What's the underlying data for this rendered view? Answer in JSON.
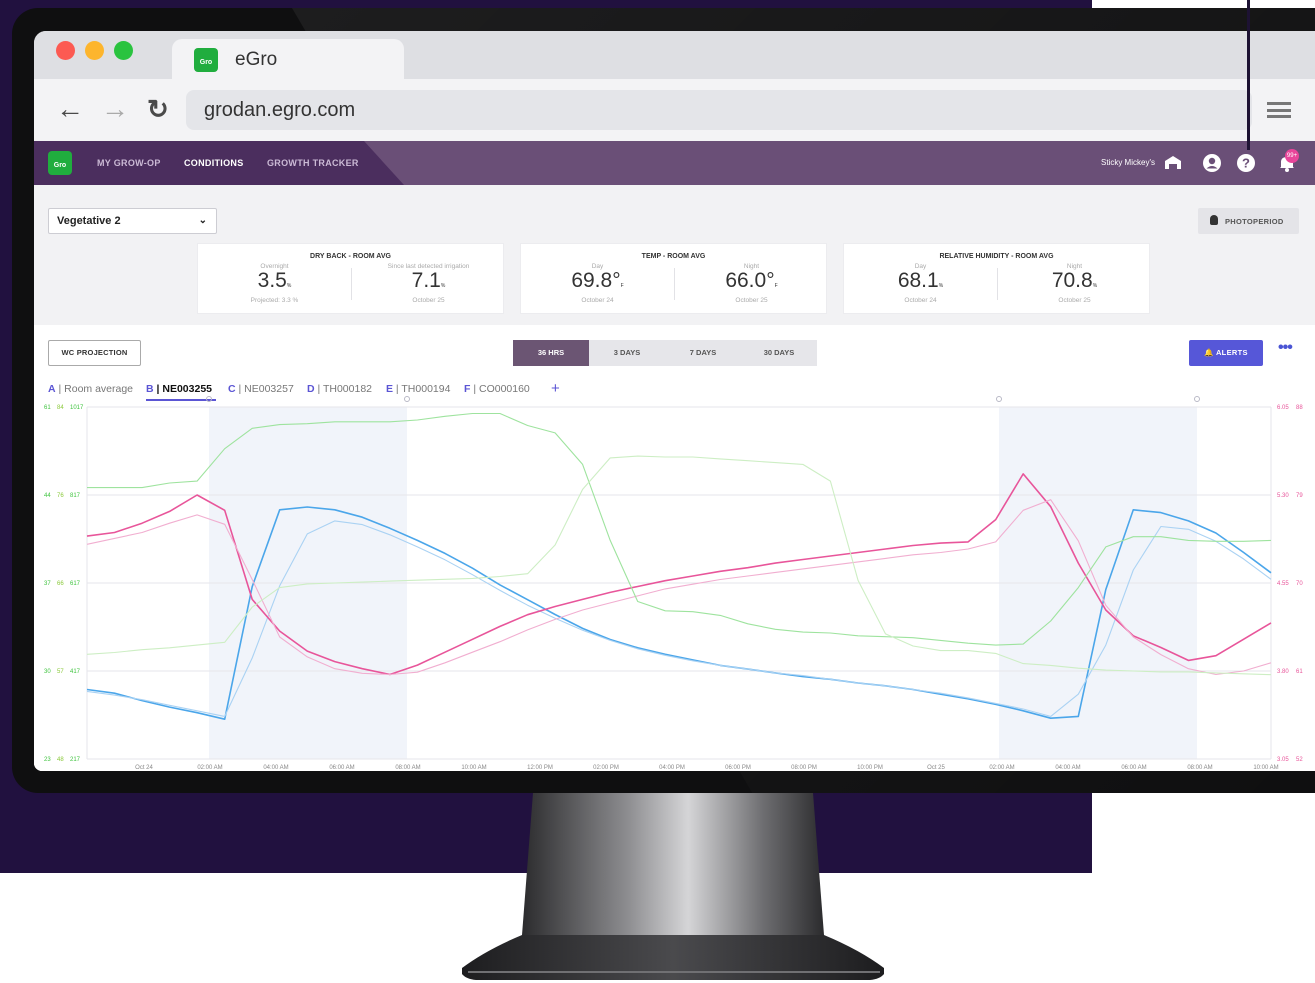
{
  "browser": {
    "tab_title": "eGro",
    "url": "grodan.egro.com",
    "back_icon": "arrow-left-icon",
    "forward_icon": "arrow-right-icon",
    "reload_icon": "reload-icon",
    "menu_icon": "hamburger-menu-icon"
  },
  "app": {
    "logo_text": "Gro",
    "nav": [
      "MY GROW-OP",
      "CONDITIONS",
      "GROWTH TRACKER"
    ],
    "active_nav": "CONDITIONS",
    "user_name": "Sticky Mickey's",
    "notification_badge": "99+",
    "brand_green": "#20ad3e",
    "nav_color": "#6a4f77"
  },
  "controls": {
    "room_select": "Vegetative 2",
    "photoperiod_label": "PHOTOPERIOD",
    "wc_projection_label": "WC PROJECTION",
    "ranges": [
      "36 HRS",
      "3 DAYS",
      "7 DAYS",
      "30 DAYS"
    ],
    "active_range": "36 HRS",
    "alerts_label": "ALERTS",
    "more_label": "•••"
  },
  "cards": [
    {
      "title": "DRY BACK - ROOM AVG",
      "left": {
        "sub": "Overnight",
        "value": "3.5",
        "unit": "%",
        "foot": "Projected: 3.3 %"
      },
      "right": {
        "sub": "Since last detected irrigation",
        "value": "7.1",
        "unit": "%",
        "foot": "October 25"
      }
    },
    {
      "title": "TEMP - ROOM AVG",
      "left": {
        "sub": "Day",
        "value": "69.8°",
        "unit": "F",
        "foot": "October 24"
      },
      "right": {
        "sub": "Night",
        "value": "66.0°",
        "unit": "F",
        "foot": "October 25"
      }
    },
    {
      "title": "RELATIVE HUMIDITY - ROOM AVG",
      "left": {
        "sub": "Day",
        "value": "68.1",
        "unit": "%",
        "foot": "October 24"
      },
      "right": {
        "sub": "Night",
        "value": "70.8",
        "unit": "%",
        "foot": "October 25"
      }
    }
  ],
  "sensor_tabs": [
    {
      "letter": "A",
      "name": "Room average"
    },
    {
      "letter": "B",
      "name": "NE003255"
    },
    {
      "letter": "C",
      "name": "NE003257"
    },
    {
      "letter": "D",
      "name": "TH000182"
    },
    {
      "letter": "E",
      "name": "TH000194"
    },
    {
      "letter": "F",
      "name": "CO000160"
    }
  ],
  "active_sensor": "B",
  "chart_data": {
    "type": "line",
    "left_axes": [
      {
        "color": "#3fc43f",
        "ticks": [
          "61",
          "44",
          "37",
          "30",
          "23"
        ]
      },
      {
        "color": "#8ac93a",
        "ticks": [
          "84",
          "76",
          "66",
          "57",
          "48"
        ]
      },
      {
        "color": "#3fc43f",
        "ticks": [
          "1017",
          "817",
          "617",
          "417",
          "217"
        ]
      }
    ],
    "right_axes": [
      {
        "color": "#e8559a",
        "ticks": [
          "6.05",
          "5.30",
          "4.55",
          "3.80",
          "3.05"
        ]
      },
      {
        "color": "#e8559a",
        "ticks": [
          "88",
          "79",
          "70",
          "61",
          "52"
        ]
      }
    ],
    "x_ticks": [
      "Oct 24",
      "02:00 AM",
      "04:00 AM",
      "06:00 AM",
      "08:00 AM",
      "10:00 AM",
      "12:00 PM",
      "02:00 PM",
      "04:00 PM",
      "06:00 PM",
      "08:00 PM",
      "10:00 PM",
      "Oct 25",
      "02:00 AM",
      "04:00 AM",
      "06:00 AM",
      "08:00 AM",
      "10:00 AM"
    ],
    "grid": true,
    "series": [
      {
        "color": "#4ba6ea",
        "values": [
          30.5,
          30.1,
          29.3,
          28.6,
          28.0,
          27.3,
          41.6,
          49.9,
          50.2,
          49.9,
          49.1,
          47.9,
          46.6,
          45.2,
          43.6,
          41.8,
          40.2,
          38.6,
          37.1,
          35.9,
          35.0,
          34.3,
          33.7,
          33.1,
          32.7,
          32.3,
          31.9,
          31.6,
          31.2,
          30.9,
          30.5,
          30.0,
          29.5,
          28.9,
          28.2,
          27.4,
          27.6,
          41.3,
          49.9,
          49.6,
          48.7,
          47.4,
          45.3,
          43.1
        ]
      },
      {
        "color": "#aad2f3",
        "values": [
          30.3,
          29.9,
          29.4,
          28.8,
          28.2,
          27.6,
          33.9,
          41.7,
          47.3,
          48.7,
          48.3,
          47.2,
          45.9,
          44.5,
          42.9,
          41.2,
          39.6,
          38.2,
          36.9,
          35.8,
          34.9,
          34.2,
          33.6,
          33.1,
          32.7,
          32.3,
          32.0,
          31.6,
          31.2,
          30.9,
          30.5,
          30.1,
          29.6,
          29.0,
          28.4,
          27.6,
          30.0,
          35.3,
          43.4,
          48.1,
          47.8,
          46.5,
          44.6,
          42.4
        ]
      },
      {
        "color": "#e8559a",
        "values": [
          4.95,
          4.98,
          5.06,
          5.16,
          5.3,
          5.17,
          4.41,
          4.14,
          3.97,
          3.88,
          3.82,
          3.77,
          3.85,
          3.96,
          4.07,
          4.18,
          4.28,
          4.35,
          4.41,
          4.47,
          4.52,
          4.57,
          4.61,
          4.65,
          4.68,
          4.72,
          4.75,
          4.78,
          4.81,
          4.84,
          4.87,
          4.89,
          4.9,
          5.09,
          5.48,
          5.2,
          4.72,
          4.32,
          4.1,
          4.0,
          3.89,
          3.93,
          4.07,
          4.21
        ]
      },
      {
        "color": "#f1aed0",
        "values": [
          4.88,
          4.93,
          4.98,
          5.06,
          5.13,
          5.05,
          4.58,
          4.09,
          3.92,
          3.82,
          3.78,
          3.77,
          3.79,
          3.87,
          3.96,
          4.05,
          4.15,
          4.24,
          4.32,
          4.38,
          4.44,
          4.5,
          4.54,
          4.58,
          4.61,
          4.64,
          4.67,
          4.7,
          4.73,
          4.76,
          4.79,
          4.81,
          4.84,
          4.9,
          5.17,
          5.26,
          4.91,
          4.36,
          4.09,
          3.94,
          3.82,
          3.77,
          3.8,
          3.87
        ]
      },
      {
        "color": "#9ee39e",
        "values": [
          52.3,
          52.3,
          52.3,
          52.8,
          53.0,
          56.5,
          58.7,
          59.1,
          59.2,
          59.4,
          59.4,
          59.4,
          59.6,
          60.0,
          60.3,
          60.3,
          59.0,
          58.2,
          54.8,
          46.6,
          40.0,
          39.0,
          38.9,
          38.5,
          37.6,
          37.0,
          36.7,
          36.6,
          36.3,
          36.2,
          36.1,
          35.8,
          35.5,
          35.3,
          35.4,
          37.9,
          41.5,
          45.9,
          47.0,
          47.0,
          46.6,
          46.5,
          46.5,
          46.6
        ]
      },
      {
        "color": "#cdeec4",
        "values": [
          34.3,
          34.5,
          34.8,
          35.0,
          35.3,
          35.6,
          39.4,
          41.5,
          41.9,
          42.0,
          42.1,
          42.2,
          42.3,
          42.4,
          42.5,
          42.7,
          43.0,
          46.1,
          52.1,
          55.5,
          55.7,
          55.6,
          55.6,
          55.4,
          55.2,
          55.0,
          54.8,
          53.0,
          42.3,
          36.5,
          35.2,
          34.7,
          34.7,
          34.4,
          33.3,
          33.1,
          32.8,
          32.6,
          32.5,
          32.4,
          32.4,
          32.3,
          32.2,
          32.1
        ]
      }
    ]
  }
}
